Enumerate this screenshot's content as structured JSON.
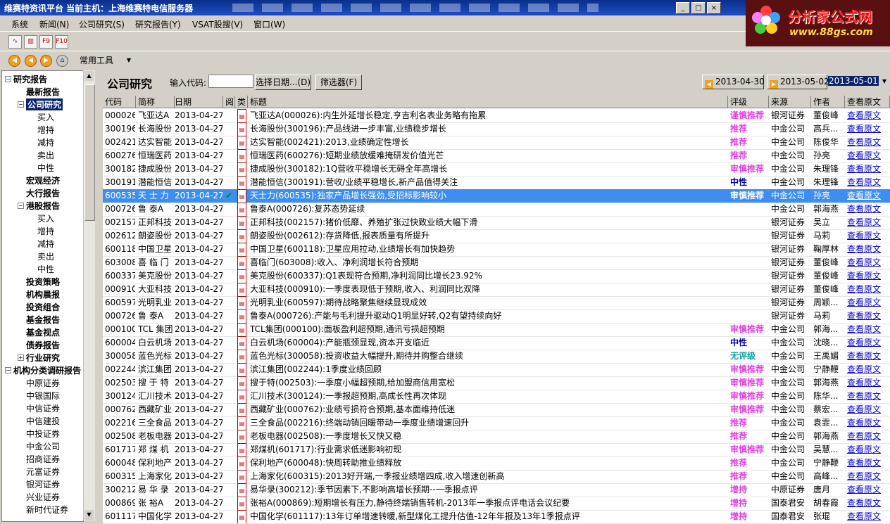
{
  "app": {
    "title": "维赛特资讯平台  当前主机：上海维赛特电信服务器",
    "logo_text": "分析家公式网",
    "logo_url_text": "www.88gs.com"
  },
  "menu": [
    "系统",
    "新闻(N)",
    "公司研究(S)",
    "研究报告(Y)",
    "VSAT股搜(V)",
    "窗口(W)"
  ],
  "toolbar": {
    "icons": [
      "chart-line-icon",
      "chart-bar-icon",
      "F9",
      "F10"
    ],
    "common_tools": "常用工具"
  },
  "tree": [
    {
      "label": "研究报告",
      "bold": true,
      "level": 0,
      "toggle": "-"
    },
    {
      "label": "最新报告",
      "bold": true,
      "level": 1
    },
    {
      "label": "公司研究",
      "bold": true,
      "level": 1,
      "toggle": "-",
      "selected": true
    },
    {
      "label": "买入",
      "level": 2
    },
    {
      "label": "增持",
      "level": 2
    },
    {
      "label": "减持",
      "level": 2
    },
    {
      "label": "卖出",
      "level": 2
    },
    {
      "label": "中性",
      "level": 2
    },
    {
      "label": "宏观经济",
      "bold": true,
      "level": 1
    },
    {
      "label": "大行报告",
      "bold": true,
      "level": 1
    },
    {
      "label": "港股报告",
      "bold": true,
      "level": 1,
      "toggle": "-"
    },
    {
      "label": "买入",
      "level": 2
    },
    {
      "label": "增持",
      "level": 2
    },
    {
      "label": "减持",
      "level": 2
    },
    {
      "label": "卖出",
      "level": 2
    },
    {
      "label": "中性",
      "level": 2
    },
    {
      "label": "投资策略",
      "bold": true,
      "level": 1
    },
    {
      "label": "机构晨报",
      "bold": true,
      "level": 1
    },
    {
      "label": "投资组合",
      "bold": true,
      "level": 1
    },
    {
      "label": "基金报告",
      "bold": true,
      "level": 1
    },
    {
      "label": "基金视点",
      "bold": true,
      "level": 1
    },
    {
      "label": "债券报告",
      "bold": true,
      "level": 1
    },
    {
      "label": "行业研究",
      "bold": true,
      "level": 1,
      "toggle": "+"
    },
    {
      "label": "机构分类调研报告",
      "bold": true,
      "level": 0,
      "toggle": "-"
    },
    {
      "label": "中原证券",
      "level": 1
    },
    {
      "label": "中银国际",
      "level": 1
    },
    {
      "label": "中信证券",
      "level": 1
    },
    {
      "label": "中信建投",
      "level": 1
    },
    {
      "label": "中投证券",
      "level": 1
    },
    {
      "label": "中金公司",
      "level": 1
    },
    {
      "label": "招商证券",
      "level": 1
    },
    {
      "label": "元富证券",
      "level": 1
    },
    {
      "label": "银河证券",
      "level": 1
    },
    {
      "label": "兴业证券",
      "level": 1
    },
    {
      "label": "新时代证券",
      "level": 1
    }
  ],
  "panel": {
    "title": "公司研究",
    "code_label": "输入代码:",
    "code_value": "",
    "date_button": "选择日期...(D)",
    "filter_button": "筛选器(F)",
    "date_prev": "2013-04-30",
    "date_next": "2013-05-02",
    "date_current": "2013-05-01"
  },
  "columns": [
    "代码",
    "简称",
    "日期",
    "阅",
    "类",
    "标题",
    "评级",
    "来源",
    "作者",
    "查看原文"
  ],
  "rating_colors": {
    "谨慎推荐": "#e040e0",
    "推荐": "#e040e0",
    "审慎推荐": "#e040e0",
    "中性": "#0000a0",
    "无评级": "#00a0a0",
    "增持": "#e040e0"
  },
  "rows": [
    {
      "code": "000026",
      "name": "飞亚达A",
      "date": "2013-04-27",
      "read": "",
      "title": "飞亚达A(000026):内生外延增长稳定,亨吉利名表业务略有拖累",
      "rating": "谨慎推荐",
      "source": "银河证券",
      "author": "董俊峰",
      "link": "查看原文"
    },
    {
      "code": "300196",
      "name": "长海股份",
      "date": "2013-04-27",
      "read": "",
      "title": "长海股份(300196):产品线进一步丰富,业绩稳步增长",
      "rating": "推荐",
      "source": "中金公司",
      "author": "高兵...",
      "link": "查看原文"
    },
    {
      "code": "002421",
      "name": "达实智能",
      "date": "2013-04-27",
      "read": "",
      "title": "达实智能(002421):2013,业绩确定性增长",
      "rating": "推荐",
      "source": "中金公司",
      "author": "陈俊华",
      "link": "查看原文"
    },
    {
      "code": "600276",
      "name": "恒瑞医药",
      "date": "2013-04-27",
      "read": "",
      "title": "恒瑞医药(600276):短期业绩放缓难掩研发价值光芒",
      "rating": "推荐",
      "source": "中金公司",
      "author": "孙亮",
      "link": "查看原文"
    },
    {
      "code": "300182",
      "name": "捷成股份",
      "date": "2013-04-27",
      "read": "",
      "title": "捷成股份(300182):1Q营收平稳增长无碍全年高增长",
      "rating": "审慎推荐",
      "source": "中金公司",
      "author": "朱理锋",
      "link": "查看原文"
    },
    {
      "code": "300191",
      "name": "潜能恒信",
      "date": "2013-04-27",
      "read": "",
      "title": "潜能恒信(300191):营收/业绩平稳增长,新产品值得关注",
      "rating": "中性",
      "source": "中金公司",
      "author": "朱理锋",
      "link": "查看原文"
    },
    {
      "code": "600535",
      "name": "天 士 力",
      "date": "2013-04-27",
      "read": "✔",
      "title": "天士力(600535):独家产品增长强劲,受招标影响较小",
      "rating": "审慎推荐",
      "source": "中金公司",
      "author": "孙亮",
      "link": "查看原文",
      "selected": true
    },
    {
      "code": "000726",
      "name": "鲁 泰A",
      "date": "2013-04-27",
      "read": "",
      "title": "鲁泰A(000726):复苏态势延续",
      "rating": "",
      "source": "中金公司",
      "author": "郭海燕",
      "link": "查看原文"
    },
    {
      "code": "002157",
      "name": "正邦科技",
      "date": "2013-04-27",
      "read": "",
      "title": "正邦科技(002157):猪价低靡、养殖扩张过快致业绩大幅下滑",
      "rating": "",
      "source": "银河证券",
      "author": "吴立",
      "link": "查看原文"
    },
    {
      "code": "002612",
      "name": "朗姿股份",
      "date": "2013-04-27",
      "read": "",
      "title": "朗姿股份(002612):存货降低,报表质量有所提升",
      "rating": "",
      "source": "银河证券",
      "author": "马莉",
      "link": "查看原文"
    },
    {
      "code": "600118",
      "name": "中国卫星",
      "date": "2013-04-27",
      "read": "",
      "title": "中国卫星(600118):卫星应用拉动,业绩增长有加快趋势",
      "rating": "",
      "source": "银河证券",
      "author": "鞠厚林",
      "link": "查看原文"
    },
    {
      "code": "603008",
      "name": "喜 临 门",
      "date": "2013-04-27",
      "read": "",
      "title": "喜临门(603008):收入、净利润增长符合预期",
      "rating": "",
      "source": "银河证券",
      "author": "董俊峰",
      "link": "查看原文"
    },
    {
      "code": "600337",
      "name": "美克股份",
      "date": "2013-04-27",
      "read": "",
      "title": "美克股份(600337):Q1表现符合预期,净利润同比增长23.92%",
      "rating": "",
      "source": "银河证券",
      "author": "董俊峰",
      "link": "查看原文"
    },
    {
      "code": "000910",
      "name": "大亚科技",
      "date": "2013-04-27",
      "read": "",
      "title": "大亚科技(000910):一季度表现低于预期,收入、利润同比双降",
      "rating": "",
      "source": "银河证券",
      "author": "董俊峰",
      "link": "查看原文"
    },
    {
      "code": "600597",
      "name": "光明乳业",
      "date": "2013-04-27",
      "read": "",
      "title": "光明乳业(600597):期待战略聚焦继续显现成效",
      "rating": "",
      "source": "银河证券",
      "author": "周颖...",
      "link": "查看原文"
    },
    {
      "code": "000726",
      "name": "鲁 泰A",
      "date": "2013-04-27",
      "read": "",
      "title": "鲁泰A(000726):产能与毛利提升驱动Q1明显好转,Q2有望持续向好",
      "rating": "",
      "source": "银河证券",
      "author": "马莉",
      "link": "查看原文"
    },
    {
      "code": "000100",
      "name": "TCL 集团",
      "date": "2013-04-27",
      "read": "",
      "title": "TCL集团(000100):面板盈利超预期,通讯亏损超预期",
      "rating": "审慎推荐",
      "source": "中金公司",
      "author": "郭海...",
      "link": "查看原文"
    },
    {
      "code": "600004",
      "name": "白云机场",
      "date": "2013-04-27",
      "read": "",
      "title": "白云机场(600004):产能瓶颈显现,资本开支临近",
      "rating": "中性",
      "source": "中金公司",
      "author": "沈晓...",
      "link": "查看原文"
    },
    {
      "code": "300058",
      "name": "蓝色光标",
      "date": "2013-04-27",
      "read": "",
      "title": "蓝色光标(300058):投资收益大幅提升,期待并购整合继续",
      "rating": "无评级",
      "source": "中金公司",
      "author": "王禹媚",
      "link": "查看原文"
    },
    {
      "code": "002244",
      "name": "滨江集团",
      "date": "2013-04-27",
      "read": "",
      "title": "滨江集团(002244):1季度业绩回顾",
      "rating": "审慎推荐",
      "source": "中金公司",
      "author": "宁静鞭",
      "link": "查看原文"
    },
    {
      "code": "002503",
      "name": "搜 于 特",
      "date": "2013-04-27",
      "read": "",
      "title": "搜于特(002503):一季度小幅超预期,给加盟商信用宽松",
      "rating": "审慎推荐",
      "source": "中金公司",
      "author": "郭海燕",
      "link": "查看原文"
    },
    {
      "code": "300124",
      "name": "汇川技术",
      "date": "2013-04-27",
      "read": "",
      "title": "汇川技术(300124):一季报超预期,高成长性再次体现",
      "rating": "审慎推荐",
      "source": "中金公司",
      "author": "陈华...",
      "link": "查看原文"
    },
    {
      "code": "000762",
      "name": "西藏矿业",
      "date": "2013-04-27",
      "read": "",
      "title": "西藏矿业(000762):业绩亏损符合预期,基本面维持低迷",
      "rating": "审慎推荐",
      "source": "中金公司",
      "author": "蔡宏...",
      "link": "查看原文"
    },
    {
      "code": "002216",
      "name": "三全食品",
      "date": "2013-04-27",
      "read": "",
      "title": "三全食品(002216):终端动销回暖带动一季度业绩增速回升",
      "rating": "推荐",
      "source": "中金公司",
      "author": "袁霏...",
      "link": "查看原文"
    },
    {
      "code": "002508",
      "name": "老板电器",
      "date": "2013-04-27",
      "read": "",
      "title": "老板电器(002508):一季度增长又快又稳",
      "rating": "推荐",
      "source": "中金公司",
      "author": "郭海燕",
      "link": "查看原文"
    },
    {
      "code": "601717",
      "name": "郑 煤 机",
      "date": "2013-04-27",
      "read": "",
      "title": "郑煤机(601717):行业需求低迷影响初现",
      "rating": "审慎推荐",
      "source": "中金公司",
      "author": "吴慧...",
      "link": "查看原文"
    },
    {
      "code": "600048",
      "name": "保利地产",
      "date": "2013-04-27",
      "read": "",
      "title": "保利地产(600048):快周转助推业绩释放",
      "rating": "推荐",
      "source": "中金公司",
      "author": "宁静鞭",
      "link": "查看原文"
    },
    {
      "code": "600315",
      "name": "上海家化",
      "date": "2013-04-27",
      "read": "",
      "title": "上海家化(600315):2013好开端,一季报业绩增四成,收入增速创新高",
      "rating": "推荐",
      "source": "中金公司",
      "author": "高峰...",
      "link": "查看原文"
    },
    {
      "code": "300212",
      "name": "易 华 录",
      "date": "2013-04-27",
      "read": "",
      "title": "易华录(300212):季节因素下,不影响高增长预期--一季报点评",
      "rating": "增持",
      "source": "中原证券",
      "author": "唐月",
      "link": "查看原文"
    },
    {
      "code": "000869",
      "name": "张 裕A",
      "date": "2013-04-27",
      "read": "",
      "title": "张裕A(000869):短期增长有压力,静待终端销售转机-2013年一季报点评电话会议纪要",
      "rating": "增持",
      "source": "国泰君安",
      "author": "胡春霞",
      "link": "查看原文"
    },
    {
      "code": "601117",
      "name": "中国化学",
      "date": "2013-04-27",
      "read": "",
      "title": "中国化学(601117):13年订单增速转暖,新型煤化工提升估值-12年年报及13年1季报点评",
      "rating": "增持",
      "source": "国泰君安",
      "author": "张琨",
      "link": "查看原文"
    }
  ]
}
